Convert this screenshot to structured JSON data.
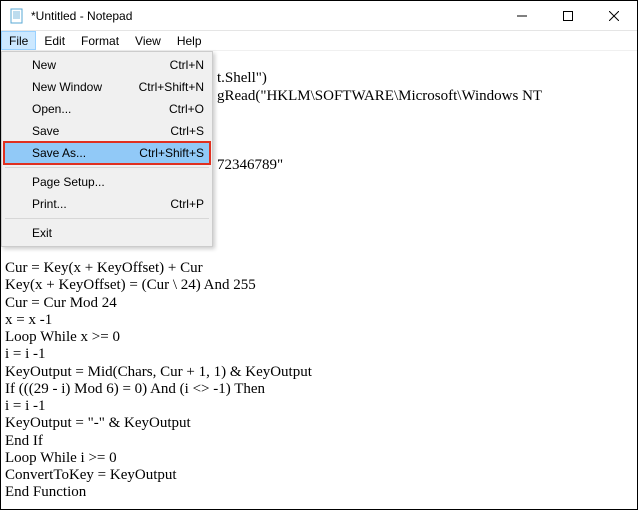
{
  "window": {
    "title": "*Untitled - Notepad"
  },
  "menubar": {
    "items": [
      "File",
      "Edit",
      "Format",
      "View",
      "Help"
    ],
    "active_index": 0
  },
  "file_menu": {
    "items": [
      {
        "label": "New",
        "shortcut": "Ctrl+N"
      },
      {
        "label": "New Window",
        "shortcut": "Ctrl+Shift+N"
      },
      {
        "label": "Open...",
        "shortcut": "Ctrl+O"
      },
      {
        "label": "Save",
        "shortcut": "Ctrl+S"
      },
      {
        "label": "Save As...",
        "shortcut": "Ctrl+Shift+S"
      },
      {
        "label": "Page Setup...",
        "shortcut": ""
      },
      {
        "label": "Print...",
        "shortcut": "Ctrl+P"
      },
      {
        "label": "Exit",
        "shortcut": ""
      }
    ],
    "highlighted_index": 4
  },
  "editor": {
    "visible_fragments": {
      "frag_shell": "t.Shell\")",
      "frag_regread": "gRead(\"HKLM\\SOFTWARE\\Microsoft\\Windows NT",
      "frag_digits": "72346789\""
    },
    "visible_lines_below": [
      "Cur = Key(x + KeyOffset) + Cur",
      "Key(x + KeyOffset) = (Cur \\ 24) And 255",
      "Cur = Cur Mod 24",
      "x = x -1",
      "Loop While x >= 0",
      "i = i -1",
      "KeyOutput = Mid(Chars, Cur + 1, 1) & KeyOutput",
      "If (((29 - i) Mod 6) = 0) And (i <> -1) Then",
      "i = i -1",
      "KeyOutput = \"-\" & KeyOutput",
      "End If",
      "Loop While i >= 0",
      "ConvertToKey = KeyOutput",
      "End Function"
    ]
  }
}
